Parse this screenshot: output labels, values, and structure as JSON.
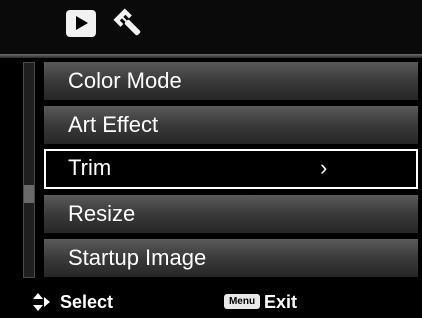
{
  "tabs": [
    {
      "icon": "playback-icon",
      "active": true
    },
    {
      "icon": "wrench-icon",
      "active": false
    }
  ],
  "menu": {
    "items": [
      {
        "label": "Color Mode"
      },
      {
        "label": "Art Effect"
      },
      {
        "label": "Trim",
        "submenu_indicator": "›"
      },
      {
        "label": "Resize"
      },
      {
        "label": "Startup Image"
      }
    ],
    "selected_index": 2
  },
  "hints": {
    "select_label": "Select",
    "menu_key": "Menu",
    "exit_label": "Exit"
  },
  "colors": {
    "background": "#000000",
    "item_gradient_top": "#5a5a5a",
    "item_gradient_bottom": "#262626",
    "highlight_border": "#ffffff",
    "text": "#ffffff"
  }
}
